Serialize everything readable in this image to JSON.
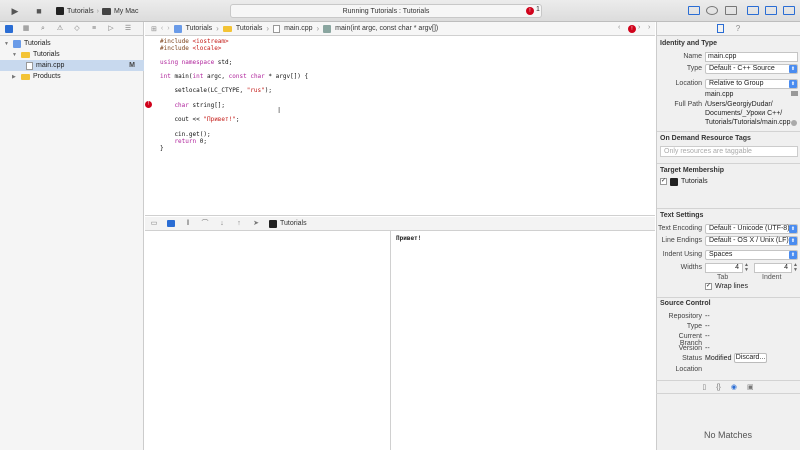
{
  "toolbar": {
    "scheme_project": "Tutorials",
    "scheme_destination": "My Mac",
    "activity_text": "Running Tutorials : Tutorials",
    "error_count": "1"
  },
  "navigator": {
    "items": [
      {
        "label": "Tutorials"
      },
      {
        "label": "Tutorials"
      },
      {
        "label": "main.cpp",
        "badge": "M"
      },
      {
        "label": "Products"
      }
    ]
  },
  "jumpbar": {
    "crumbs": [
      "Tutorials",
      "Tutorials",
      "main.cpp",
      "main(int argc, const char * argv[])"
    ]
  },
  "editor": {
    "lines": [
      {
        "pp": "#include ",
        "inc": "<iostream>"
      },
      {
        "pp": "#include ",
        "inc": "<locale>"
      },
      {
        "text": ""
      },
      {
        "kw": "using namespace ",
        "text": "std;"
      },
      {
        "text": ""
      },
      {
        "kw": "int ",
        "text": "main(",
        "kw2": "int ",
        "text2": "argc, ",
        "kw3": "const char ",
        "text3": "* argv[]) {"
      },
      {
        "text": ""
      },
      {
        "text": "    setlocale(LC_CTYPE, ",
        "str": "\"rus\"",
        "text2": ");"
      },
      {
        "text": ""
      },
      {
        "kw": "    char ",
        "text": "string[];"
      },
      {
        "text": ""
      },
      {
        "text": "    cout << ",
        "str": "\"Привет!\"",
        "text2": ";"
      },
      {
        "text": ""
      },
      {
        "text": "    cin.get();"
      },
      {
        "kw": "    return ",
        "text": "0;"
      },
      {
        "text": "}"
      }
    ],
    "error_marker": "!"
  },
  "debug": {
    "target": "Tutorials"
  },
  "console": {
    "output": "Привет!"
  },
  "inspector": {
    "identity_header": "Identity and Type",
    "name_label": "Name",
    "name_value": "main.cpp",
    "type_label": "Type",
    "type_value": "Default - C++ Source",
    "location_label": "Location",
    "location_value": "Relative to Group",
    "location_file": "main.cpp",
    "fullpath_label": "Full Path",
    "fullpath_lines": [
      "/Users/GeorgiyDudar/",
      "Documents/_Уроки C++/",
      "Tutorials/Tutorials/main.cpp"
    ],
    "odr_header": "On Demand Resource Tags",
    "odr_placeholder": "Only resources are taggable",
    "target_header": "Target Membership",
    "target_name": "Tutorials",
    "text_header": "Text Settings",
    "encoding_label": "Text Encoding",
    "encoding_value": "Default - Unicode (UTF-8)",
    "endings_label": "Line Endings",
    "endings_value": "Default - OS X / Unix (LF)",
    "indent_label": "Indent Using",
    "indent_value": "Spaces",
    "widths_label": "Widths",
    "tab_value": "4",
    "indent_width_value": "4",
    "tab_caption": "Tab",
    "indent_caption": "Indent",
    "wrap_label": "Wrap lines",
    "sc_header": "Source Control",
    "repo_label": "Repository",
    "repo_value": "--",
    "sctype_label": "Type",
    "sctype_value": "--",
    "branch_label": "Current Branch",
    "branch_value": "--",
    "version_label": "Version",
    "version_value": "--",
    "status_label": "Status",
    "status_value": "Modified",
    "discard_label": "Discard...",
    "sclocation_label": "Location",
    "no_matches": "No Matches"
  }
}
